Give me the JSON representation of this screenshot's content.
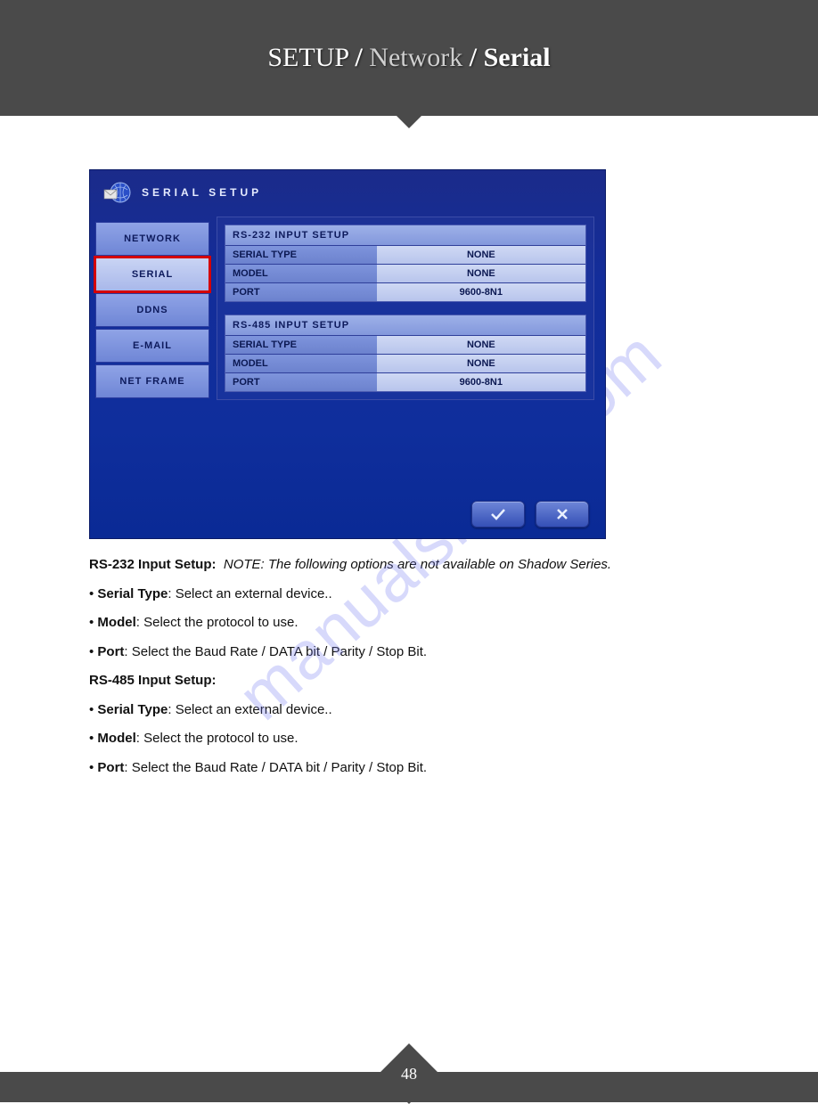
{
  "breadcrumb": {
    "seg1": "SETUP",
    "sep1": "/",
    "seg2": "Network",
    "sep2": "/",
    "seg3": "Serial"
  },
  "dvr": {
    "title": "SERIAL SETUP",
    "tabs": {
      "network": "NETWORK",
      "serial": "SERIAL",
      "ddns": "DDNS",
      "email": "E-MAIL",
      "netframe": "NET FRAME"
    },
    "group232": {
      "title": "RS-232 INPUT SETUP",
      "serial_type_label": "SERIAL TYPE",
      "serial_type_value": "NONE",
      "model_label": "MODEL",
      "model_value": "NONE",
      "port_label": "PORT",
      "port_value": "9600-8N1"
    },
    "group485": {
      "title": "RS-485 INPUT SETUP",
      "serial_type_label": "SERIAL TYPE",
      "serial_type_value": "NONE",
      "model_label": "MODEL",
      "model_value": "NONE",
      "port_label": "PORT",
      "port_value": "9600-8N1"
    }
  },
  "text": {
    "rs232_heading": "RS-232 Input Setup:",
    "rs232_note": "NOTE: The following options are not available on Shadow Series.",
    "serial_type_label": "Serial Type",
    "serial_type_desc": ": Select an external device..",
    "model_label": "Model",
    "model_desc": ": Select the protocol to use.",
    "port_label": "Port",
    "port_desc": ": Select the Baud Rate / DATA bit / Parity / Stop Bit.",
    "rs485_heading": "RS-485 Input Setup:"
  },
  "watermark": "manualshive.com",
  "page_number": "48"
}
